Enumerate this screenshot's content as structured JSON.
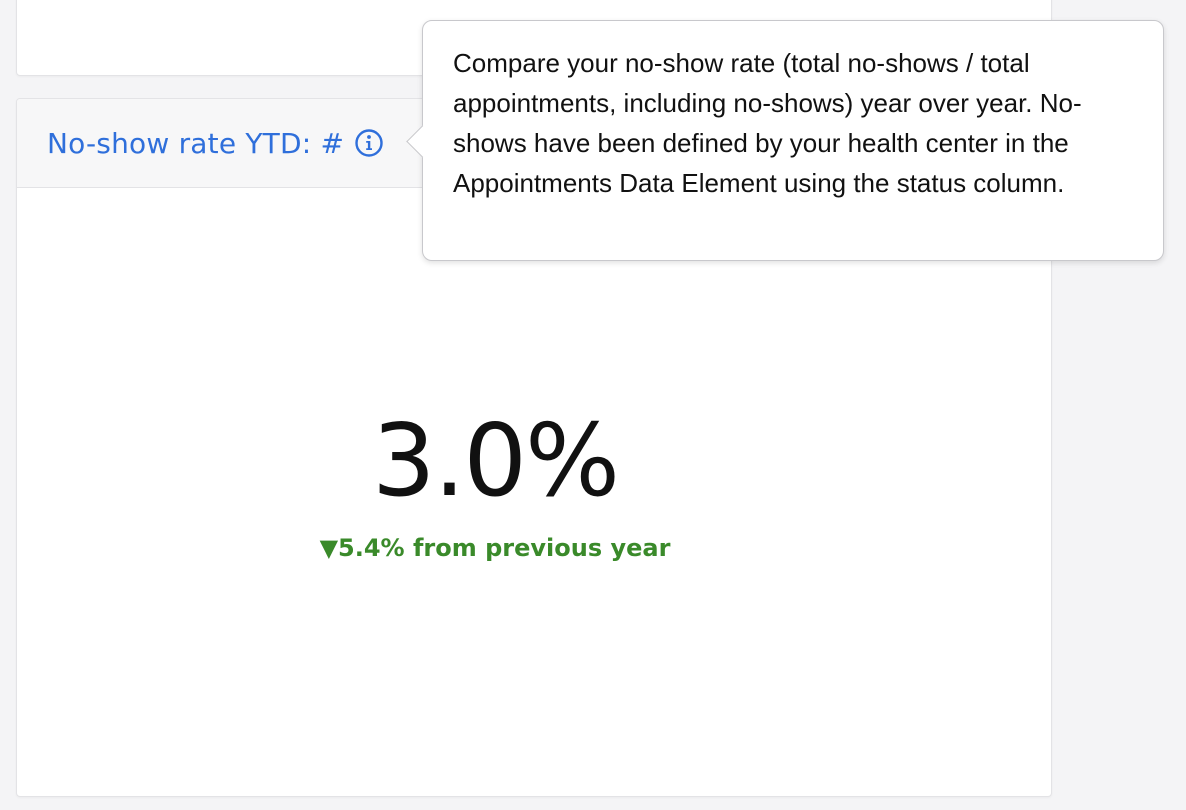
{
  "card": {
    "title": "No-show rate YTD: #",
    "info_icon": "info-circle-icon",
    "metric_value": "3.0%",
    "change_text": "▼5.4% from previous year",
    "change_color": "#3a8a2a",
    "title_color": "#2f6fdb"
  },
  "tooltip": {
    "text": "Compare your no-show rate (total no-shows / total appointments, including no-shows) year over year. No-shows have been defined by your health center in the Appointments Data Element using the status column."
  }
}
